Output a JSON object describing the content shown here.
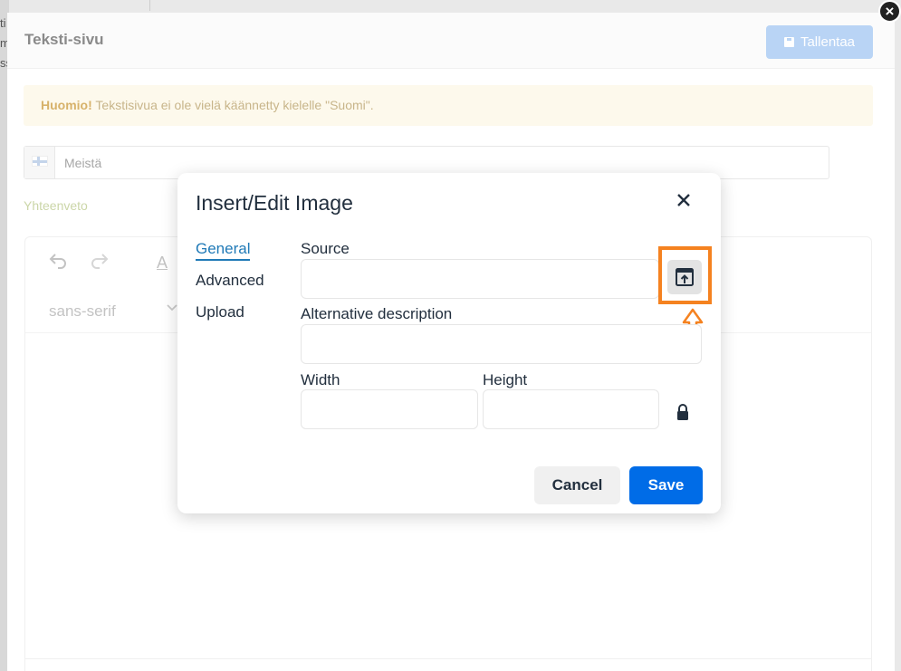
{
  "background": {
    "left_fragments": [
      "ti",
      "m",
      "ss"
    ]
  },
  "panel": {
    "title": "Teksti-sivu",
    "save_label": "Tallentaa",
    "notice_bold": "Huomio!",
    "notice_text": "Tekstisivua ei ole vielä käännetty kielelle \"Suomi\".",
    "language_value": "Meistä",
    "summary_label": "Yhteenveto",
    "editor": {
      "font_family": "sans-serif",
      "undo_icon": "undo-icon",
      "redo_icon": "redo-icon",
      "text_color_icon": "text-color-icon",
      "font_letter": "A"
    },
    "close_icon": "close-circle-icon"
  },
  "dialog": {
    "title": "Insert/Edit Image",
    "close_icon": "close-icon",
    "tabs": [
      {
        "label": "General",
        "active": true
      },
      {
        "label": "Advanced",
        "active": false
      },
      {
        "label": "Upload",
        "active": false
      }
    ],
    "fields": {
      "source_label": "Source",
      "source_value": "",
      "alt_label": "Alternative description",
      "alt_value": "",
      "width_label": "Width",
      "width_value": "",
      "height_label": "Height",
      "height_value": ""
    },
    "browse_icon": "browse-upload-icon",
    "lock_icon": "lock-icon",
    "cancel_label": "Cancel",
    "save_label": "Save"
  },
  "colors": {
    "accent": "#006ce7",
    "highlight": "#f58220",
    "tab_active": "#207ab7"
  }
}
